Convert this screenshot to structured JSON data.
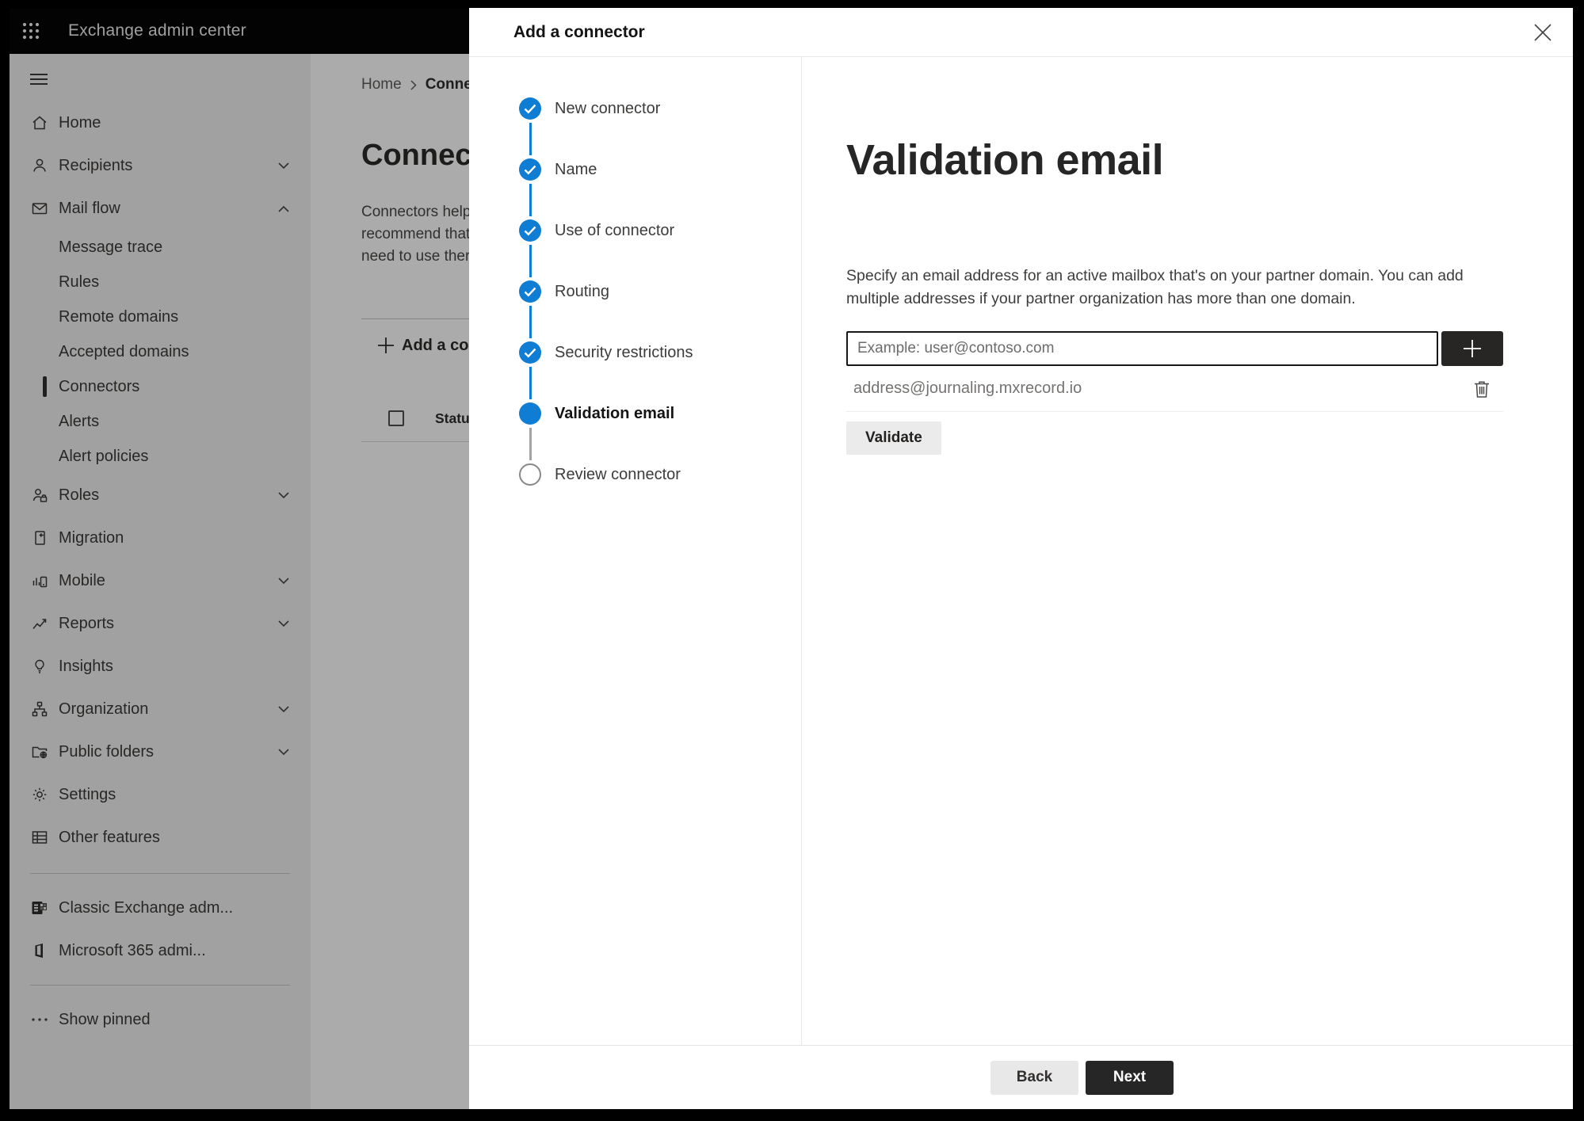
{
  "topbar": {
    "app_title": "Exchange admin center"
  },
  "sidebar": {
    "items": [
      {
        "label": "Home",
        "icon": "home-icon"
      },
      {
        "label": "Recipients",
        "icon": "person-icon",
        "chevron": "down"
      },
      {
        "label": "Mail flow",
        "icon": "mail-icon",
        "chevron": "up",
        "expanded": true
      },
      {
        "label": "Message trace",
        "type": "sub"
      },
      {
        "label": "Rules",
        "type": "sub"
      },
      {
        "label": "Remote domains",
        "type": "sub"
      },
      {
        "label": "Accepted domains",
        "type": "sub"
      },
      {
        "label": "Connectors",
        "type": "sub",
        "selected": true
      },
      {
        "label": "Alerts",
        "type": "sub"
      },
      {
        "label": "Alert policies",
        "type": "sub"
      },
      {
        "label": "Roles",
        "icon": "roles-icon",
        "chevron": "down"
      },
      {
        "label": "Migration",
        "icon": "migration-icon"
      },
      {
        "label": "Mobile",
        "icon": "mobile-icon",
        "chevron": "down"
      },
      {
        "label": "Reports",
        "icon": "reports-icon",
        "chevron": "down"
      },
      {
        "label": "Insights",
        "icon": "insights-icon"
      },
      {
        "label": "Organization",
        "icon": "organization-icon",
        "chevron": "down"
      },
      {
        "label": "Public folders",
        "icon": "public-folders-icon",
        "chevron": "down"
      },
      {
        "label": "Settings",
        "icon": "settings-icon"
      },
      {
        "label": "Other features",
        "icon": "other-features-icon"
      }
    ],
    "footer_items": [
      {
        "label": "Classic Exchange adm...",
        "icon": "classic-exchange-logo-icon"
      },
      {
        "label": "Microsoft 365 admi...",
        "icon": "microsoft-365-logo-icon"
      }
    ],
    "show_pinned_label": "Show pinned"
  },
  "background_page": {
    "breadcrumb": {
      "home": "Home",
      "current_truncated": "Conne"
    },
    "title_truncated": "Connec",
    "intro_lines_truncated": [
      "Connectors help",
      "recommend that",
      "need to use ther"
    ],
    "add_connector_button_truncated": "Add a conn",
    "table": {
      "status_header": "Status"
    }
  },
  "dialog": {
    "title": "Add a connector",
    "steps": [
      {
        "label": "New connector",
        "state": "complete"
      },
      {
        "label": "Name",
        "state": "complete"
      },
      {
        "label": "Use of connector",
        "state": "complete"
      },
      {
        "label": "Routing",
        "state": "complete"
      },
      {
        "label": "Security restrictions",
        "state": "complete"
      },
      {
        "label": "Validation email",
        "state": "current"
      },
      {
        "label": "Review connector",
        "state": "upcoming"
      }
    ],
    "content": {
      "heading": "Validation email",
      "description": "Specify an email address for an active mailbox that's on your partner domain. You can add multiple addresses if your partner organization has more than one domain.",
      "email_input": {
        "placeholder": "Example: user@contoso.com",
        "value": ""
      },
      "addresses": [
        "address@journaling.mxrecord.io"
      ],
      "validate_button_label": "Validate"
    },
    "footer": {
      "back_label": "Back",
      "next_label": "Next"
    }
  },
  "colors": {
    "accent_blue": "#0f7dd3",
    "topbar_bg": "#050505",
    "sidebar_bg": "#f2f1f0",
    "dark_button_bg": "#262626",
    "neutral_button_bg": "#e9e8e8",
    "upcoming_step_gray": "#8a8886",
    "overlay": "rgba(0,0,0,0.33)"
  }
}
